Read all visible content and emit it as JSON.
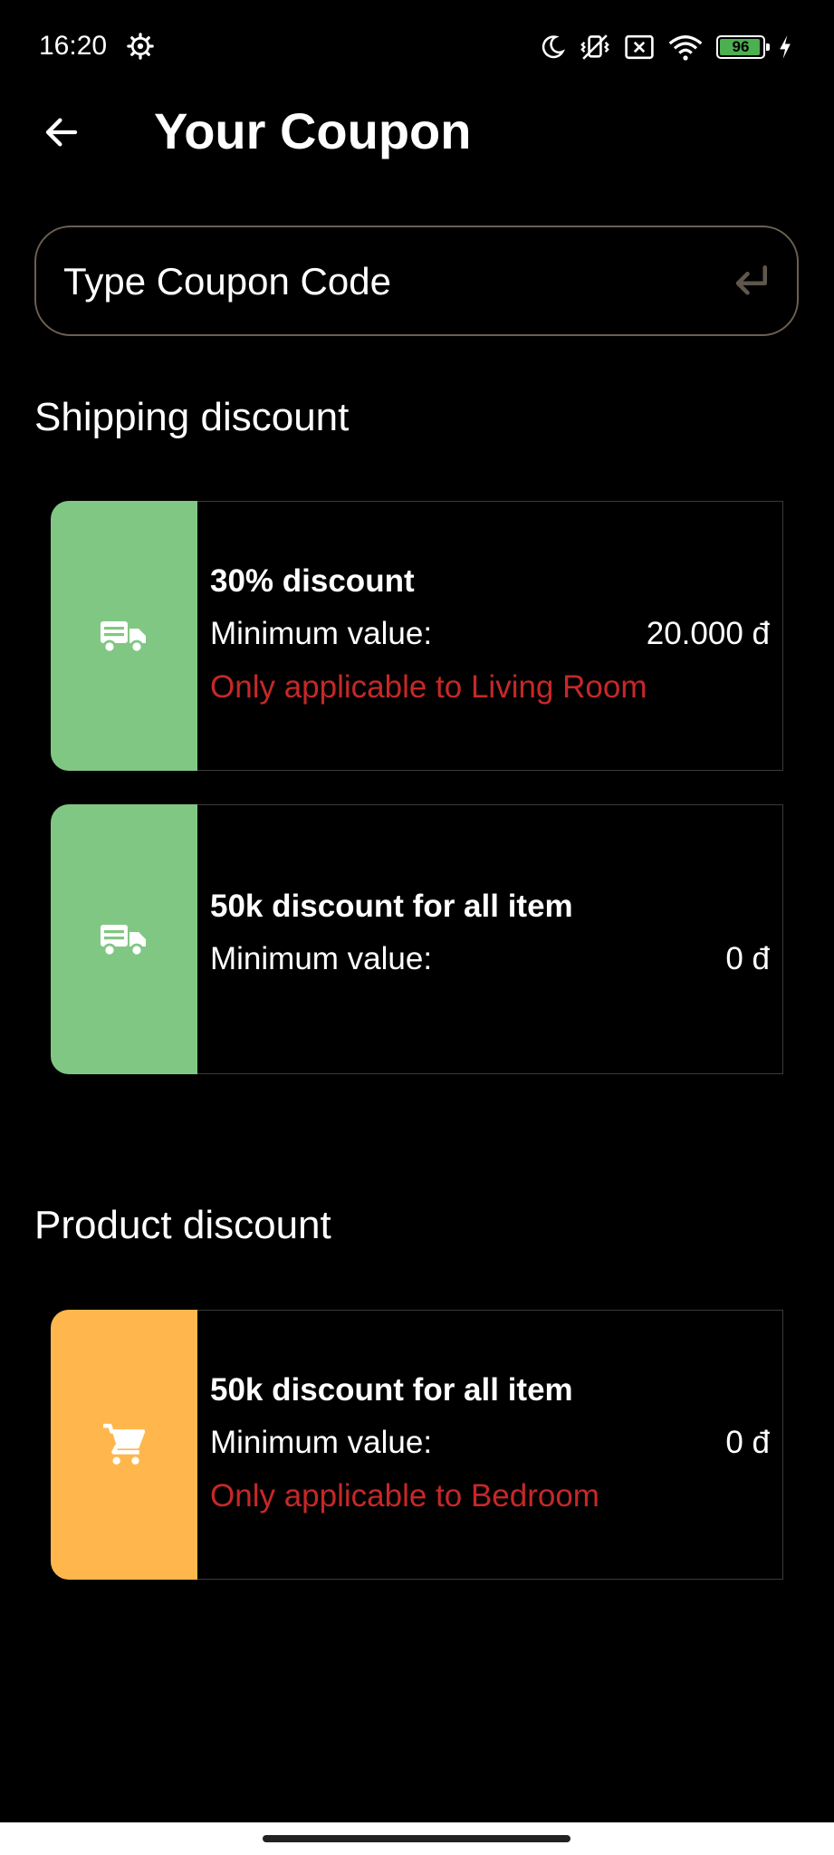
{
  "status_bar": {
    "time": "16:20",
    "battery": "96",
    "battery_level": 0.96,
    "icons": [
      "gear-icon",
      "moon-icon",
      "vibrate-off-icon",
      "sim-x-icon",
      "wifi-icon",
      "battery-icon",
      "charging-bolt-icon"
    ]
  },
  "header": {
    "title": "Your Coupon",
    "back_icon": "arrow-left-icon"
  },
  "coupon_input": {
    "placeholder": "Type Coupon Code",
    "value": "",
    "submit_icon": "enter-return-icon"
  },
  "sections": {
    "shipping": {
      "title": "Shipping discount",
      "coupons": [
        {
          "title": "30% discount",
          "min_label": "Minimum value:",
          "min_value": "20.000 đ",
          "note": "Only applicable to Living Room",
          "icon": "truck-icon",
          "color": "#81c784"
        },
        {
          "title": "50k discount for all item",
          "min_label": "Minimum value:",
          "min_value": "0 đ",
          "note": "",
          "icon": "truck-icon",
          "color": "#81c784"
        }
      ]
    },
    "product": {
      "title": "Product discount",
      "coupons": [
        {
          "title": "50k discount for all item",
          "min_label": "Minimum value:",
          "min_value": "0 đ",
          "note": "Only applicable to Bedroom",
          "icon": "cart-icon",
          "color": "#ffb74d"
        }
      ]
    }
  },
  "colors": {
    "background": "#000000",
    "shipping_accent": "#81c784",
    "product_accent": "#ffb74d",
    "note_red": "#c62828",
    "input_border": "#6b5f52"
  }
}
